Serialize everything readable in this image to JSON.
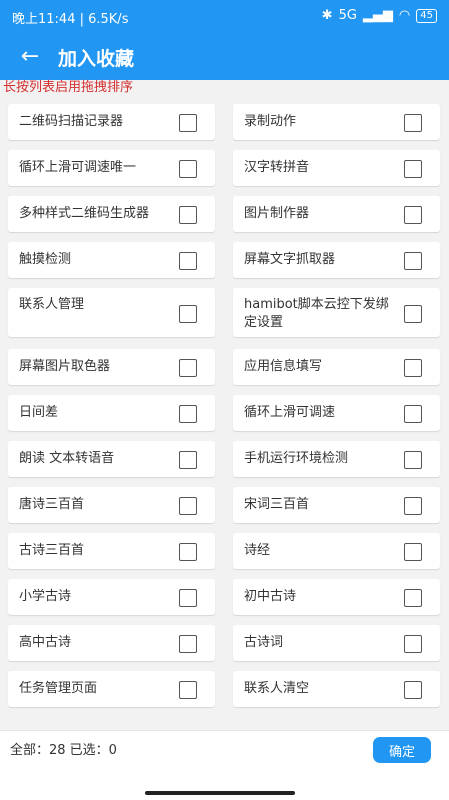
{
  "status": {
    "time_speed": "晚上11:44 | 6.5K/s",
    "network": "5G",
    "battery": "45"
  },
  "appbar": {
    "title": "加入收藏"
  },
  "hint": "长按列表启用拖拽排序",
  "items": [
    {
      "label": "二维码扫描记录器",
      "checked": false
    },
    {
      "label": "录制动作",
      "checked": false
    },
    {
      "label": "循环上滑可调速唯一",
      "checked": false
    },
    {
      "label": "汉字转拼音",
      "checked": false
    },
    {
      "label": "多种样式二维码生成器",
      "checked": false
    },
    {
      "label": "图片制作器",
      "checked": false
    },
    {
      "label": "触摸检测",
      "checked": false
    },
    {
      "label": "屏幕文字抓取器",
      "checked": false
    },
    {
      "label": "联系人管理",
      "checked": false
    },
    {
      "label": "hamibot脚本云控下发绑定设置",
      "checked": false
    },
    {
      "label": "屏幕图片取色器",
      "checked": false
    },
    {
      "label": "应用信息填写",
      "checked": false
    },
    {
      "label": "日间差",
      "checked": false
    },
    {
      "label": "循环上滑可调速",
      "checked": false
    },
    {
      "label": "朗读 文本转语音",
      "checked": false
    },
    {
      "label": "手机运行环境检测",
      "checked": false
    },
    {
      "label": "唐诗三百首",
      "checked": false
    },
    {
      "label": "宋词三百首",
      "checked": false
    },
    {
      "label": "古诗三百首",
      "checked": false
    },
    {
      "label": "诗经",
      "checked": false
    },
    {
      "label": "小学古诗",
      "checked": false
    },
    {
      "label": "初中古诗",
      "checked": false
    },
    {
      "label": "高中古诗",
      "checked": false
    },
    {
      "label": "古诗词",
      "checked": false
    },
    {
      "label": "任务管理页面",
      "checked": false
    },
    {
      "label": "联系人清空",
      "checked": false
    }
  ],
  "footer": {
    "summary": "全部：28 已选：0",
    "confirm_label": "确定"
  },
  "colors": {
    "accent": "#2196f3",
    "hint": "#d32f2f"
  }
}
